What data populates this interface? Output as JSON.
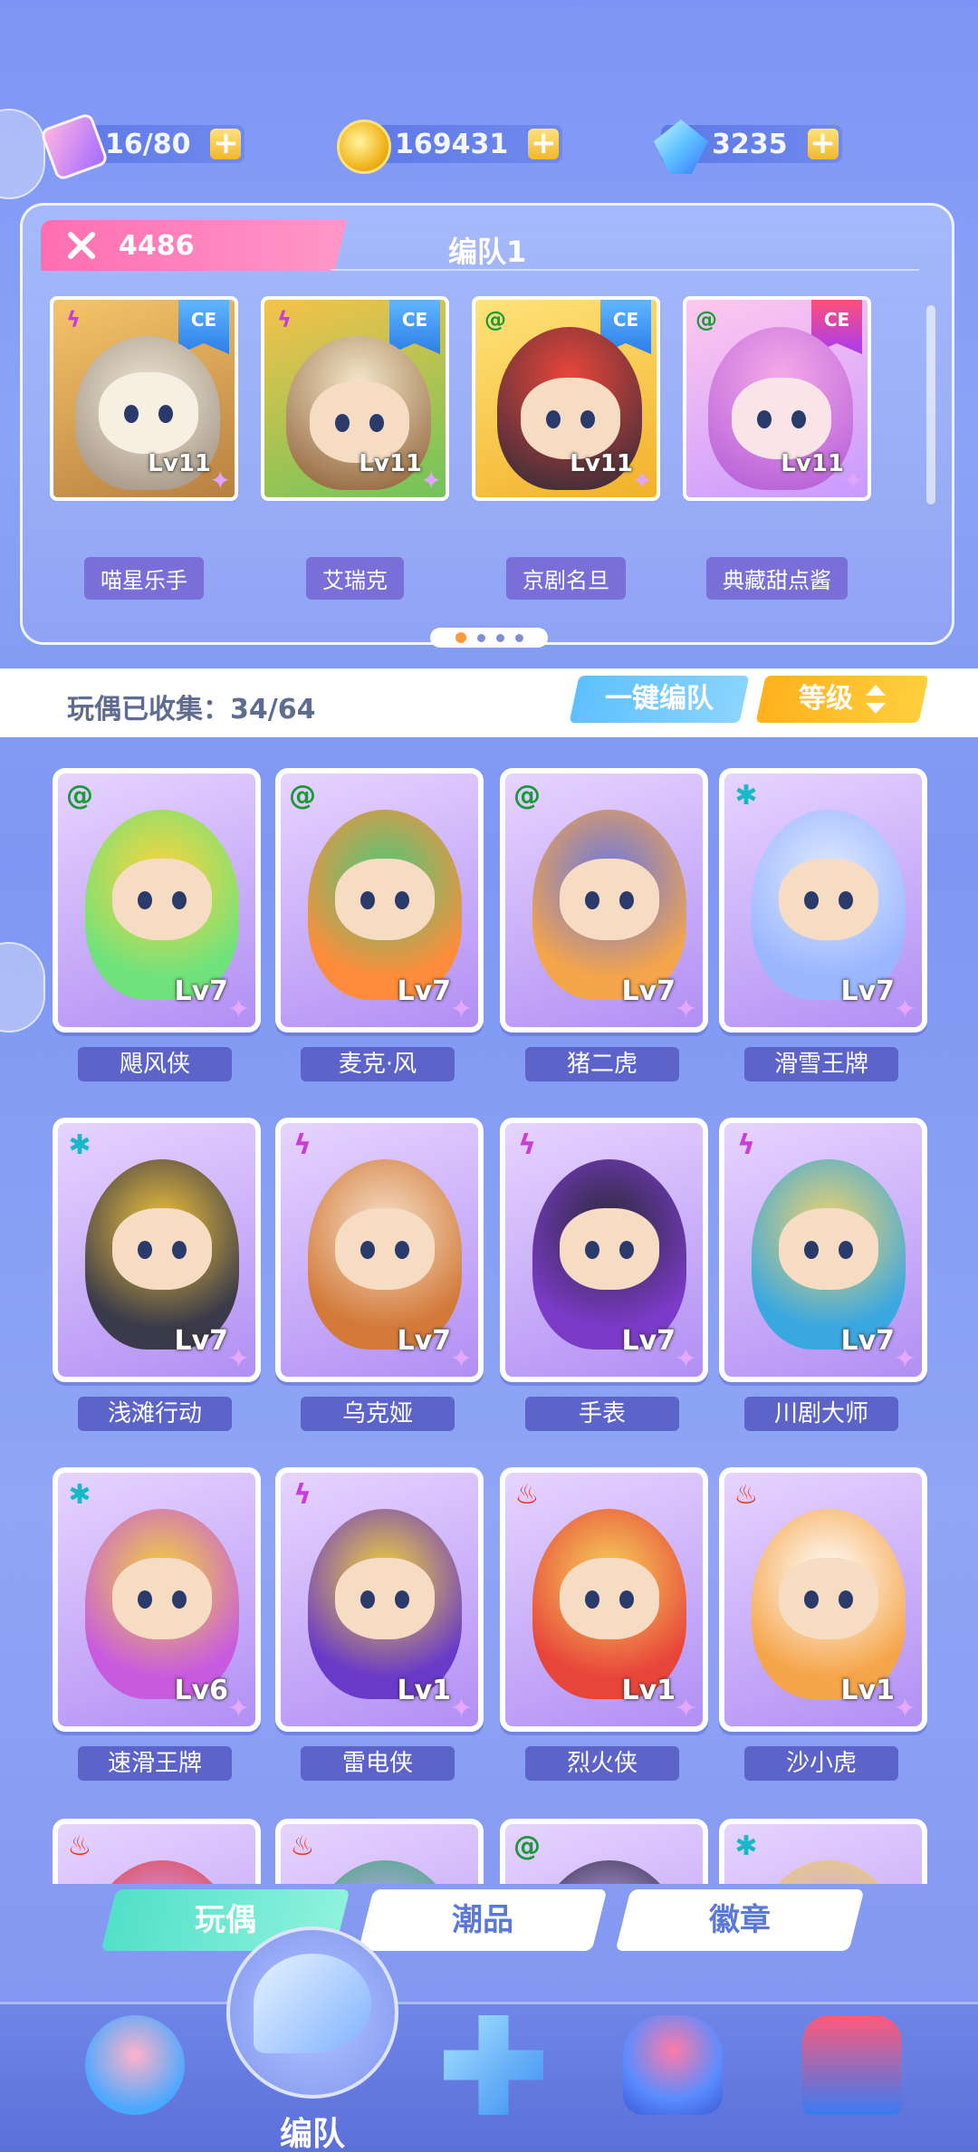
{
  "resources": [
    {
      "icon": "ticket-icon",
      "value": "16/80",
      "add": "+"
    },
    {
      "icon": "coin-icon",
      "value": "169431",
      "add": "+"
    },
    {
      "icon": "gem-icon",
      "value": "3235",
      "add": "+"
    }
  ],
  "team": {
    "power": "4486",
    "title": "编队1",
    "members": [
      {
        "name": "喵星乐手",
        "level": "Lv11",
        "element": "ϟ",
        "badge": "CE"
      },
      {
        "name": "艾瑞克",
        "level": "Lv11",
        "element": "ϟ",
        "badge": "CE"
      },
      {
        "name": "京剧名旦",
        "level": "Lv11",
        "element": "@",
        "badge": "CE"
      },
      {
        "name": "典藏甜点酱",
        "level": "Lv11",
        "element": "@",
        "badge": "CE"
      }
    ],
    "page_count": 4,
    "active_page": 1
  },
  "collection": {
    "label": "玩偶已收集：34/64",
    "auto_button": "一键编队",
    "sort_button": "等级"
  },
  "dolls": [
    {
      "name": "飓风侠",
      "level": "Lv7",
      "element": "@",
      "element_color": "green",
      "palette": [
        "#6fe27c",
        "#ffd43b"
      ]
    },
    {
      "name": "麦克·风",
      "level": "Lv7",
      "element": "@",
      "element_color": "green",
      "palette": [
        "#ff8c3a",
        "#4dc97a"
      ]
    },
    {
      "name": "猪二虎",
      "level": "Lv7",
      "element": "@",
      "element_color": "green",
      "palette": [
        "#f5a54a",
        "#6b78e0"
      ]
    },
    {
      "name": "滑雪王牌",
      "level": "Lv7",
      "element": "✱",
      "element_color": "blue",
      "palette": [
        "#9ab6ff",
        "#dfe9ff"
      ]
    },
    {
      "name": "浅滩行动",
      "level": "Lv7",
      "element": "✱",
      "element_color": "blue",
      "palette": [
        "#3a3a4a",
        "#f2c33a"
      ]
    },
    {
      "name": "乌克娅",
      "level": "Lv7",
      "element": "ϟ",
      "element_color": "yellow",
      "palette": [
        "#d37a3a",
        "#f5e0c8"
      ]
    },
    {
      "name": "手表",
      "level": "Lv7",
      "element": "ϟ",
      "element_color": "yellow",
      "palette": [
        "#7b3ac8",
        "#2b2b3a"
      ]
    },
    {
      "name": "川剧大师",
      "level": "Lv7",
      "element": "ϟ",
      "element_color": "yellow",
      "palette": [
        "#3aa8e0",
        "#f2d36a"
      ]
    },
    {
      "name": "速滑王牌",
      "level": "Lv6",
      "element": "✱",
      "element_color": "blue",
      "palette": [
        "#c85ae0",
        "#f2d33a"
      ]
    },
    {
      "name": "雷电侠",
      "level": "Lv1",
      "element": "ϟ",
      "element_color": "yellow",
      "palette": [
        "#6a3ac8",
        "#f2d33a"
      ]
    },
    {
      "name": "烈火侠",
      "level": "Lv1",
      "element": "♨",
      "element_color": "red",
      "palette": [
        "#e8453a",
        "#f5d25a"
      ]
    },
    {
      "name": "沙小虎",
      "level": "Lv1",
      "element": "♨",
      "element_color": "red",
      "palette": [
        "#f5a54a",
        "#ffffff"
      ]
    },
    {
      "name": "",
      "level": "",
      "element": "♨",
      "element_color": "red",
      "palette": [
        "#e83a3a",
        "#c8a8ff"
      ]
    },
    {
      "name": "",
      "level": "",
      "element": "♨",
      "element_color": "red",
      "palette": [
        "#3aa86a",
        "#c8a8ff"
      ]
    },
    {
      "name": "",
      "level": "",
      "element": "@",
      "element_color": "green",
      "palette": [
        "#2b2b3a",
        "#c8a8ff"
      ]
    },
    {
      "name": "",
      "level": "",
      "element": "✱",
      "element_color": "blue",
      "palette": [
        "#f5d25a",
        "#c8a8ff"
      ]
    }
  ],
  "category_tabs": [
    {
      "label": "玩偶",
      "active": true
    },
    {
      "label": "潮品",
      "active": false
    },
    {
      "label": "徽章",
      "active": false
    }
  ],
  "bottom_nav": [
    {
      "icon": "trophy-arrow-icon",
      "label": ""
    },
    {
      "icon": "whistle-icon",
      "label": "编队",
      "active": true
    },
    {
      "icon": "gamepad-icon",
      "label": ""
    },
    {
      "icon": "trophy-icon",
      "label": ""
    },
    {
      "icon": "gacha-machine-icon",
      "label": ""
    }
  ],
  "colors": {
    "background": "#8aa4f7",
    "power_tab": "#ff6fb0",
    "auto_button": "#5ec0ff",
    "sort_button": "#ffb11c",
    "active_tab": "#52e0c8",
    "name_plate": "#5c63c9"
  }
}
